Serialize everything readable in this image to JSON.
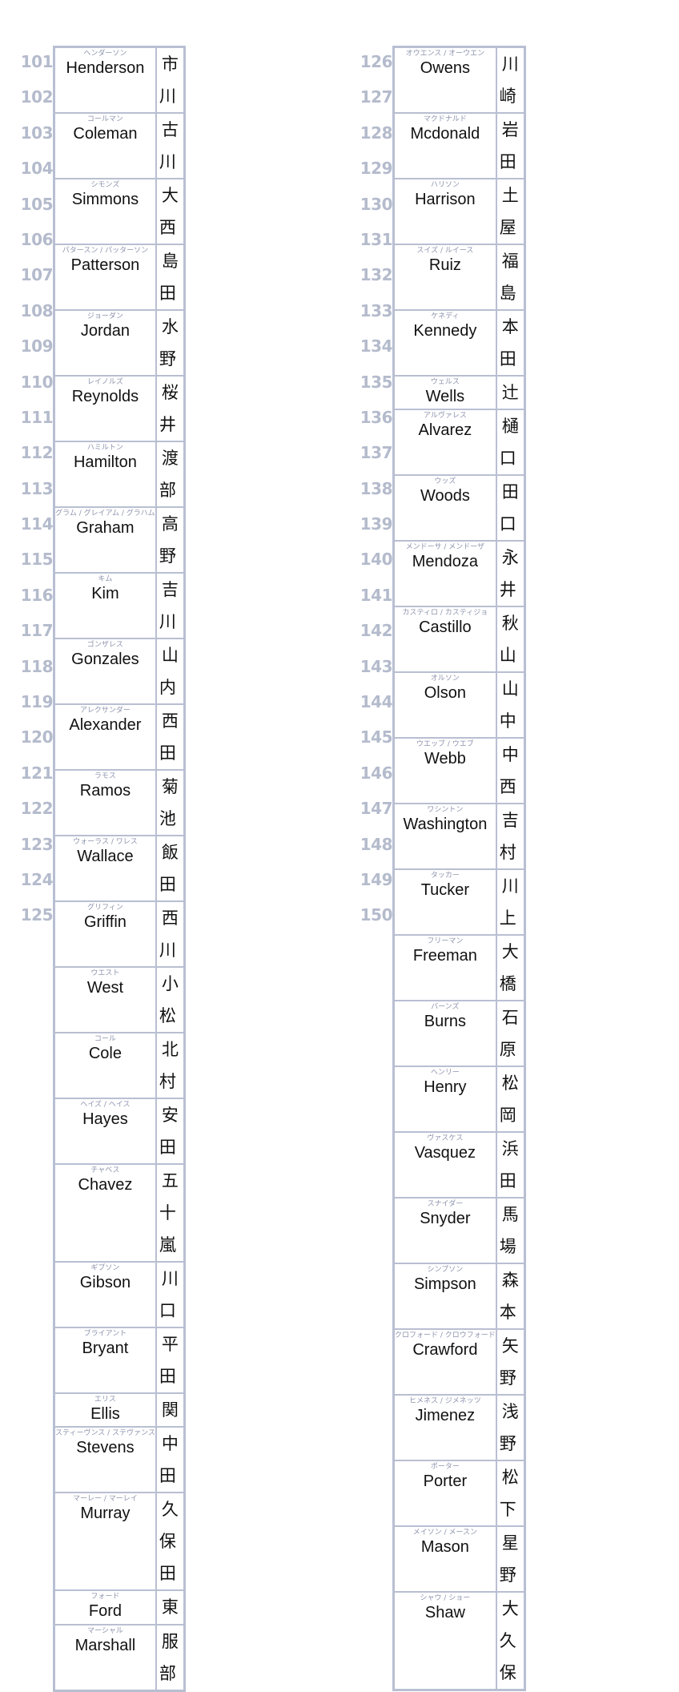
{
  "columns": [
    {
      "entries": [
        {
          "number": "101",
          "kana": "ヘンダーソン",
          "english": "Henderson",
          "japanese": "市川"
        },
        {
          "number": "102",
          "kana": "コールマン",
          "english": "Coleman",
          "japanese": "古川"
        },
        {
          "number": "103",
          "kana": "シモンズ",
          "english": "Simmons",
          "japanese": "大西"
        },
        {
          "number": "104",
          "kana": "パタースン / パッターソン",
          "english": "Patterson",
          "japanese": "島田"
        },
        {
          "number": "105",
          "kana": "ジョーダン",
          "english": "Jordan",
          "japanese": "水野"
        },
        {
          "number": "106",
          "kana": "レイノルズ",
          "english": "Reynolds",
          "japanese": "桜井"
        },
        {
          "number": "107",
          "kana": "ハミルトン",
          "english": "Hamilton",
          "japanese": "渡部"
        },
        {
          "number": "108",
          "kana": "グラム / グレイアム / グラハム",
          "english": "Graham",
          "japanese": "高野"
        },
        {
          "number": "109",
          "kana": "キム",
          "english": "Kim",
          "japanese": "吉川"
        },
        {
          "number": "110",
          "kana": "ゴンザレス",
          "english": "Gonzales",
          "japanese": "山内"
        },
        {
          "number": "111",
          "kana": "アレクサンダー",
          "english": "Alexander",
          "japanese": "西田"
        },
        {
          "number": "112",
          "kana": "ラモス",
          "english": "Ramos",
          "japanese": "菊池"
        },
        {
          "number": "113",
          "kana": "ウォーラス / ワレス",
          "english": "Wallace",
          "japanese": "飯田"
        },
        {
          "number": "114",
          "kana": "グリフィン",
          "english": "Griffin",
          "japanese": "西川"
        },
        {
          "number": "115",
          "kana": "ウエスト",
          "english": "West",
          "japanese": "小松"
        },
        {
          "number": "116",
          "kana": "コール",
          "english": "Cole",
          "japanese": "北村"
        },
        {
          "number": "117",
          "kana": "ヘイズ / ヘイス",
          "english": "Hayes",
          "japanese": "安田"
        },
        {
          "number": "118",
          "kana": "チャベス",
          "english": "Chavez",
          "japanese": "五十嵐"
        },
        {
          "number": "119",
          "kana": "ギブソン",
          "english": "Gibson",
          "japanese": "川口"
        },
        {
          "number": "120",
          "kana": "ブライアント",
          "english": "Bryant",
          "japanese": "平田"
        },
        {
          "number": "121",
          "kana": "エリス",
          "english": "Ellis",
          "japanese": "関"
        },
        {
          "number": "122",
          "kana": "スティーヴンス / ステヴァンス",
          "english": "Stevens",
          "japanese": "中田"
        },
        {
          "number": "123",
          "kana": "マーレー / マーレイ",
          "english": "Murray",
          "japanese": "久保田"
        },
        {
          "number": "124",
          "kana": "フォード",
          "english": "Ford",
          "japanese": "東"
        },
        {
          "number": "125",
          "kana": "マーシャル",
          "english": "Marshall",
          "japanese": "服部"
        }
      ]
    },
    {
      "entries": [
        {
          "number": "126",
          "kana": "オウエンス / オーウエン",
          "english": "Owens",
          "japanese": "川崎"
        },
        {
          "number": "127",
          "kana": "マクドナルド",
          "english": "Mcdonald",
          "japanese": "岩田"
        },
        {
          "number": "128",
          "kana": "ハリソン",
          "english": "Harrison",
          "japanese": "土屋"
        },
        {
          "number": "129",
          "kana": "スイズ / ルイース",
          "english": "Ruiz",
          "japanese": "福島"
        },
        {
          "number": "130",
          "kana": "ケネディ",
          "english": "Kennedy",
          "japanese": "本田"
        },
        {
          "number": "131",
          "kana": "ウェルス",
          "english": "Wells",
          "japanese": "辻"
        },
        {
          "number": "132",
          "kana": "アルヴァレス",
          "english": "Alvarez",
          "japanese": "樋口"
        },
        {
          "number": "133",
          "kana": "ウッズ",
          "english": "Woods",
          "japanese": "田口"
        },
        {
          "number": "134",
          "kana": "メンドーサ / メンドーザ",
          "english": "Mendoza",
          "japanese": "永井"
        },
        {
          "number": "135",
          "kana": "カスティロ / カスティジョ",
          "english": "Castillo",
          "japanese": "秋山"
        },
        {
          "number": "136",
          "kana": "オルソン",
          "english": "Olson",
          "japanese": "山中"
        },
        {
          "number": "137",
          "kana": "ウエッブ / ウエブ",
          "english": "Webb",
          "japanese": "中西"
        },
        {
          "number": "138",
          "kana": "ワシントン",
          "english": "Washington",
          "japanese": "吉村"
        },
        {
          "number": "139",
          "kana": "タッカー",
          "english": "Tucker",
          "japanese": "川上"
        },
        {
          "number": "140",
          "kana": "フリーマン",
          "english": "Freeman",
          "japanese": "大橋"
        },
        {
          "number": "141",
          "kana": "バーンズ",
          "english": "Burns",
          "japanese": "石原"
        },
        {
          "number": "142",
          "kana": "ヘンリー",
          "english": "Henry",
          "japanese": "松岡"
        },
        {
          "number": "143",
          "kana": "ヴァスケス",
          "english": "Vasquez",
          "japanese": "浜田"
        },
        {
          "number": "144",
          "kana": "スナイダー",
          "english": "Snyder",
          "japanese": "馬場"
        },
        {
          "number": "145",
          "kana": "シンプソン",
          "english": "Simpson",
          "japanese": "森本"
        },
        {
          "number": "146",
          "kana": "クロフォード / クロウフォード",
          "english": "Crawford",
          "japanese": "矢野"
        },
        {
          "number": "147",
          "kana": "ヒメネス / ジメネッツ",
          "english": "Jimenez",
          "japanese": "浅野"
        },
        {
          "number": "148",
          "kana": "ポーター",
          "english": "Porter",
          "japanese": "松下"
        },
        {
          "number": "149",
          "kana": "メイソン / メースン",
          "english": "Mason",
          "japanese": "星野"
        },
        {
          "number": "150",
          "kana": "シャウ / ショー",
          "english": "Shaw",
          "japanese": "大久保"
        }
      ]
    }
  ],
  "colors": {
    "border": "#b9bfd2",
    "number": "#b4bbcc",
    "kana": "#8d94ad",
    "text": "#111111"
  }
}
